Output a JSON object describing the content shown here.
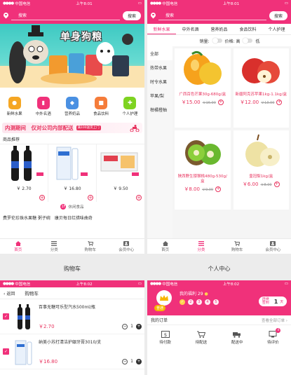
{
  "status": {
    "carrier": "中国电信",
    "time1": "上午8:01",
    "time2": "上午8:02"
  },
  "colors": {
    "accent": "#f0317a",
    "price": "#e8335e"
  },
  "home": {
    "search_placeholder": "搜索",
    "search_button": "搜索",
    "banner_text": "单身狗粮",
    "quick": [
      {
        "label": "新鲜水果",
        "icon": "fruit-icon",
        "color": "#f5a623"
      },
      {
        "label": "中外名酒",
        "icon": "wine-icon",
        "color": "#f0317a"
      },
      {
        "label": "营养奶品",
        "icon": "milk-icon",
        "color": "#4a90e2"
      },
      {
        "label": "食品饮料",
        "icon": "snack-icon",
        "color": "#f57c3a"
      },
      {
        "label": "个人护理",
        "icon": "care-icon",
        "color": "#7ed321"
      }
    ],
    "promo_text": "内测期间　仅对公司内部配送",
    "promo_badge": "满100送货上门",
    "section_title": "商品推荐",
    "products": [
      {
        "price": "￥ 2.70"
      },
      {
        "price": "￥ 16.80"
      },
      {
        "price": "￥ 9.50"
      }
    ],
    "page_badge": "1F",
    "page_label": "休闲食品",
    "shop_cards": [
      "费罗伦珍珠水果糖 粥子碗",
      "康贝每日红措味曲奇"
    ]
  },
  "tabs": [
    {
      "label": "首页",
      "icon": "home-icon"
    },
    {
      "label": "分类",
      "icon": "category-icon"
    },
    {
      "label": "购物车",
      "icon": "cart-icon"
    },
    {
      "label": "会员中心",
      "icon": "member-icon"
    }
  ],
  "category": {
    "search_placeholder": "搜索",
    "search_button": "搜索",
    "top_tabs": [
      "新鲜水果",
      "中外名酒",
      "营养奶品",
      "食品饮料",
      "个人护理"
    ],
    "sort": {
      "sales": "销量:",
      "price": "价格: 高",
      "low": "低"
    },
    "side": [
      "全部",
      "热带水果",
      "时令水果",
      "苹果/梨",
      "柑橘橙柚"
    ],
    "items": [
      {
        "name": "广西百色芒果30g-680g/盒",
        "price": "￥15.00",
        "old": "￥16.00"
      },
      {
        "name": "新疆阿克苏苹果1kg-1.1kg/盒",
        "price": "￥12.00",
        "old": "￥13.00"
      },
      {
        "name": "陕西野生猕猴桃480g-530g/盒",
        "price": "￥8.00",
        "old": "￥9.00"
      },
      {
        "name": "皇冠梨1kg/盒",
        "price": "￥6.00",
        "old": "￥8.00"
      }
    ]
  },
  "captions": {
    "cart": "购物车",
    "member": "个人中心"
  },
  "cart": {
    "back": "返回",
    "title": "购物车",
    "items": [
      {
        "name": "百事无糖可乐型汽水500ml/瓶",
        "price": "￥2.70",
        "qty": "1"
      },
      {
        "name": "纳美小苏打清洁护龈牙膏3010/支",
        "price": "￥16.80",
        "qty": "1"
      }
    ]
  },
  "member": {
    "welfare": "我的福利 29",
    "vip": "普通",
    "days": [
      "2",
      "3",
      "4",
      "5"
    ],
    "sign_label": "连续签到",
    "sign_days": "1",
    "sign_unit": "天",
    "orders_title": "我的订单",
    "orders_all": "查看全部订单",
    "orders": [
      {
        "label": "待付款",
        "icon": "wallet-icon"
      },
      {
        "label": "待配送",
        "icon": "cart-icon"
      },
      {
        "label": "配送中",
        "icon": "truck-icon"
      },
      {
        "label": "待评价",
        "icon": "review-icon",
        "badge": "4"
      }
    ]
  }
}
